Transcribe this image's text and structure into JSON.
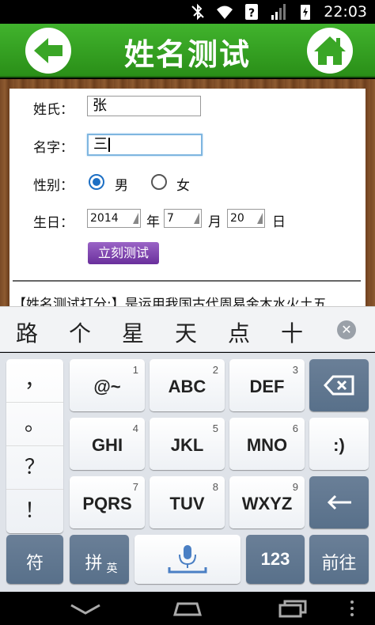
{
  "status_bar": {
    "time": "22:03",
    "icons": [
      "bluetooth-off-icon",
      "wifi-icon",
      "notification-icon",
      "signal-icon",
      "battery-charging-icon"
    ]
  },
  "header": {
    "title": "姓名测试",
    "back_icon": "back-arrow-icon",
    "home_icon": "home-icon",
    "accent_color": "#3aa626"
  },
  "form": {
    "surname_label": "姓氏：",
    "surname_value": "张",
    "given_name_label": "名字：",
    "given_name_value": "三",
    "gender_label": "性别：",
    "gender_options": [
      "男",
      "女"
    ],
    "gender_selected": "男",
    "birthday_label": "生日：",
    "year_value": "2014",
    "year_unit": "年",
    "month_value": "7",
    "month_unit": "月",
    "day_value": "20",
    "day_unit": "日",
    "submit_label": "立刻测试"
  },
  "description": "【姓名测试打分:】是运用我国古代周易金木水火土五",
  "candidates": [
    "路",
    "个",
    "星",
    "天",
    "点",
    "十"
  ],
  "keyboard": {
    "punctuation": [
      "，",
      "。",
      "？",
      "！"
    ],
    "keys": [
      {
        "label": "@~",
        "num": "1"
      },
      {
        "label": "ABC",
        "num": "2"
      },
      {
        "label": "DEF",
        "num": "3"
      },
      {
        "label": "GHI",
        "num": "4"
      },
      {
        "label": "JKL",
        "num": "5"
      },
      {
        "label": "MNO",
        "num": "6"
      },
      {
        "label": "PQRS",
        "num": "7"
      },
      {
        "label": "TUV",
        "num": "8"
      },
      {
        "label": "WXYZ",
        "num": "9"
      }
    ],
    "smiley_label": ":)",
    "symbol_label": "符",
    "pinyin_label": "拼",
    "english_label": "英",
    "num_label": "123",
    "go_label": "前往"
  }
}
